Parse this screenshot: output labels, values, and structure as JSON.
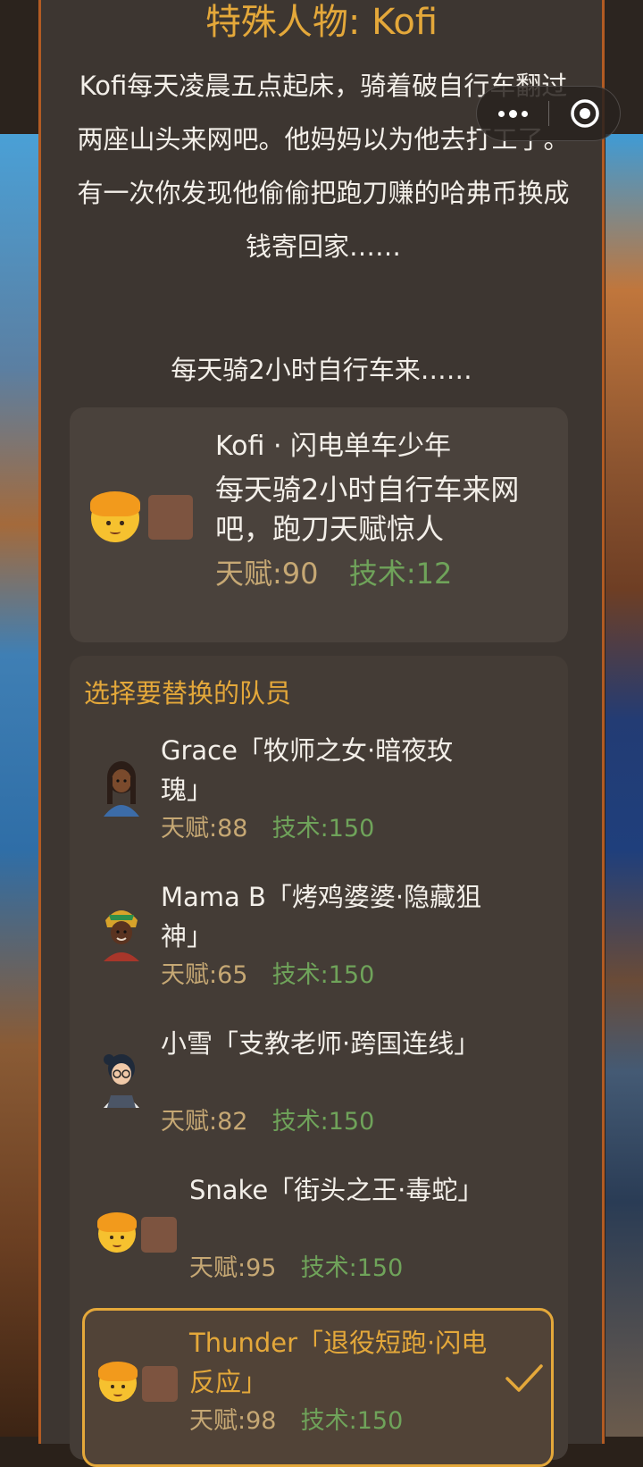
{
  "header": {
    "title": "特殊人物: Kofi",
    "story": "Kofi每天凌晨五点起床，骑着破自行车翻过两座山头来网吧。他妈妈以为他去打工了。有一次你发现他偷偷把跑刀赚的哈弗币换成钱寄回家……",
    "tagline": "每天骑2小时自行车来……"
  },
  "capsule": {
    "more_icon": "more-dots-icon",
    "close_icon": "target-close-icon"
  },
  "new_member": {
    "name": "Kofi · 闪电单车少年",
    "desc": "每天骑2小时自行车来网吧，跑刀天赋惊人",
    "talent": "天赋:90",
    "skill": "技术:12"
  },
  "replace": {
    "heading": "选择要替换的队员",
    "members": [
      {
        "name": "Grace「牧师之女·暗夜玫瑰」",
        "talent": "天赋:88",
        "skill": "技术:150",
        "selected": false
      },
      {
        "name": "Mama B「烤鸡婆婆·隐藏狙神」",
        "talent": "天赋:65",
        "skill": "技术:150",
        "selected": false
      },
      {
        "name": "小雪「支教老师·跨国连线」",
        "talent": "天赋:82",
        "skill": "技术:150",
        "selected": false
      },
      {
        "name": "Snake「街头之王·毒蛇」",
        "talent": "天赋:95",
        "skill": "技术:150",
        "selected": false
      },
      {
        "name": "Thunder「退役短跑·闪电反应」",
        "talent": "天赋:98",
        "skill": "技术:150",
        "selected": true
      }
    ]
  },
  "colors": {
    "accent": "#e4a83a",
    "talent": "#c6a874",
    "skill": "#6fa35a",
    "panel_border": "#b25b23"
  }
}
